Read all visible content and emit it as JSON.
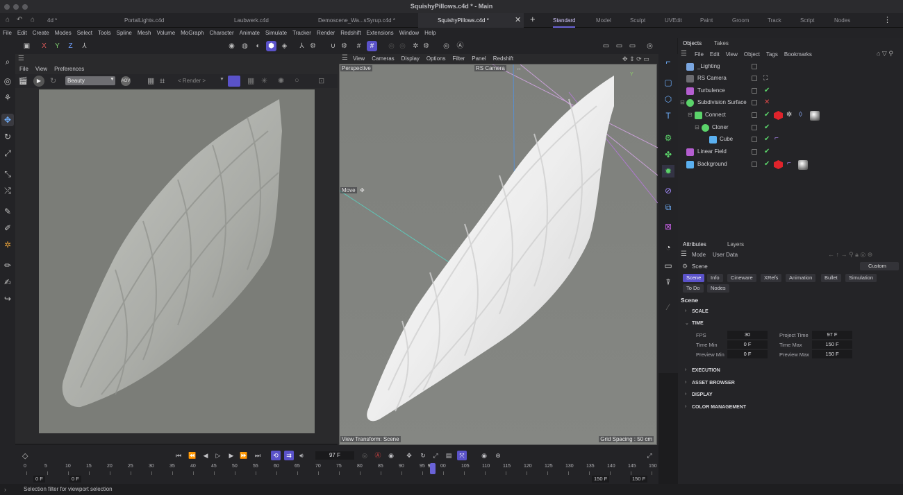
{
  "window": {
    "title": "SquishyPillows.c4d * - Main"
  },
  "file_tabs": [
    {
      "label": "4d *"
    },
    {
      "label": "PortalLights.c4d"
    },
    {
      "label": "Laubwerk.c4d"
    },
    {
      "label": "Demoscene_Wa...sSyrup.c4d *"
    },
    {
      "label": "SquishyPillows.c4d *",
      "active": true
    }
  ],
  "layouts": [
    "Standard",
    "Model",
    "Sculpt",
    "UVEdit",
    "Paint",
    "Groom",
    "Track",
    "Script",
    "Nodes"
  ],
  "menu": [
    "File",
    "Edit",
    "Create",
    "Modes",
    "Select",
    "Tools",
    "Spline",
    "Mesh",
    "Volume",
    "MoGraph",
    "Character",
    "Animate",
    "Simulate",
    "Tracker",
    "Render",
    "Redshift",
    "Extensions",
    "Window",
    "Help"
  ],
  "toolbar": {
    "x": "X",
    "y": "Y",
    "z": "Z"
  },
  "render_view": {
    "menu": [
      "File",
      "View",
      "Preferences"
    ],
    "aov": "Beauty",
    "render_dropdown": "< Render >"
  },
  "viewport": {
    "menu": [
      "View",
      "Cameras",
      "Display",
      "Options",
      "Filter",
      "Panel",
      "Redshift"
    ],
    "name": "Perspective",
    "camera": "RS Camera",
    "tool": "Move",
    "view_transform": "View Transform: Scene",
    "grid_spacing": "Grid Spacing : 50 cm"
  },
  "objects_panel": {
    "tabs": [
      "Objects",
      "Takes"
    ],
    "menu": [
      "File",
      "Edit",
      "View",
      "Object",
      "Tags",
      "Bookmarks"
    ],
    "items": [
      {
        "name": "_Lighting"
      },
      {
        "name": "RS Camera"
      },
      {
        "name": "Turbulence"
      },
      {
        "name": "Subdivision Surface"
      },
      {
        "name": "Connect"
      },
      {
        "name": "Cloner"
      },
      {
        "name": "Cube"
      },
      {
        "name": "Linear Field"
      },
      {
        "name": "Background"
      }
    ]
  },
  "attributes_panel": {
    "tabs": [
      "Attributes",
      "Layers"
    ],
    "mode_menu": [
      "Mode",
      "User Data"
    ],
    "context": "Scene",
    "preset": "Custom",
    "subtabs": [
      "Scene",
      "Info",
      "Cineware",
      "XRefs",
      "Animation",
      "Bullet",
      "Simulation",
      "To Do",
      "Nodes"
    ],
    "heading": "Scene",
    "sections": [
      "SCALE",
      "TIME",
      "EXECUTION",
      "ASSET BROWSER",
      "DISPLAY",
      "COLOR MANAGEMENT"
    ],
    "time_fields": {
      "fps_label": "FPS",
      "fps": "30",
      "project_time_label": "Project Time",
      "project_time": "97 F",
      "time_min_label": "Time Min",
      "time_min": "0 F",
      "time_max_label": "Time Max",
      "time_max": "150 F",
      "preview_min_label": "Preview Min",
      "preview_min": "0 F",
      "preview_max_label": "Preview Max",
      "preview_max": "150 F"
    }
  },
  "timeline": {
    "current_frame": "97 F",
    "ticks": [
      "0",
      "5",
      "10",
      "15",
      "20",
      "25",
      "30",
      "35",
      "40",
      "45",
      "50",
      "55",
      "60",
      "65",
      "70",
      "75",
      "80",
      "85",
      "90",
      "95",
      "97",
      "00",
      "105",
      "110",
      "115",
      "120",
      "125",
      "130",
      "135",
      "140",
      "145",
      "150"
    ],
    "start": "0 F",
    "preview_start": "0 F",
    "preview_end": "150 F",
    "end": "150 F"
  },
  "status": "Selection filter for viewport selection",
  "colors": {
    "accent": "#5a52c9",
    "check": "#5bd36a",
    "tag_red": "#e0232b"
  }
}
